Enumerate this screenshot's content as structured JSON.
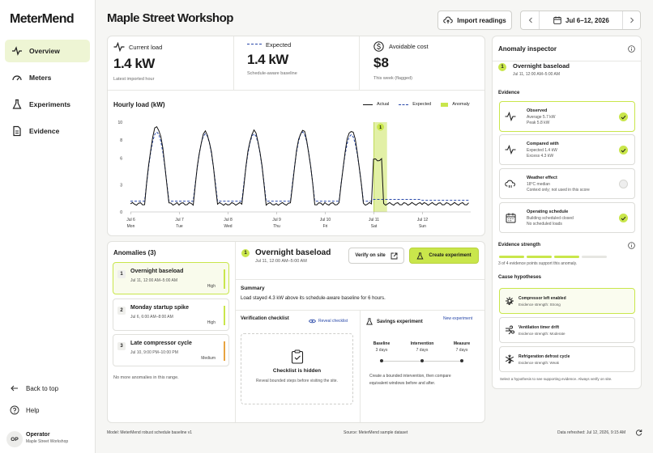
{
  "app": {
    "name": "MeterMend"
  },
  "sidebar": {
    "items": [
      {
        "label": "Overview",
        "icon": "pulse-icon"
      },
      {
        "label": "Meters",
        "icon": "gauge-icon"
      },
      {
        "label": "Experiments",
        "icon": "flask-icon"
      },
      {
        "label": "Evidence",
        "icon": "document-icon"
      }
    ],
    "back_to_top": "Back to top",
    "help": "Help",
    "user": {
      "initials": "OP",
      "name": "Operator",
      "org": "Maple Street Workshop"
    }
  },
  "header": {
    "title": "Maple Street Workshop",
    "import_label": "Import readings",
    "date_range": "Jul 6–12, 2026"
  },
  "kpis": [
    {
      "label": "Current load",
      "value": "1.4 kW",
      "sub": "Latest imported hour"
    },
    {
      "label": "Expected",
      "value": "1.4 kW",
      "sub": "Schedule-aware baseline"
    },
    {
      "label": "Avoidable cost",
      "value": "$8",
      "sub": "This week (flagged)"
    }
  ],
  "chart_data": {
    "type": "line",
    "title": "Hourly load (kW)",
    "ylim": [
      0,
      10
    ],
    "yticks": [
      0,
      3,
      6,
      8,
      10
    ],
    "x": [
      "Jul 6 Mon",
      "Jul 7 Tue",
      "Jul 8 Wed",
      "Jul 9 Thu",
      "Jul 10 Fri",
      "Jul 11 Sat",
      "Jul 12 Sun"
    ],
    "legend": [
      "Actual",
      "Expected",
      "Anomaly"
    ],
    "series": [
      {
        "name": "Actual",
        "peaks": [
          9.5,
          8.9,
          9.0,
          9.1,
          9.1,
          5.8,
          0.9
        ],
        "baseline": 0.9
      },
      {
        "name": "Expected",
        "peaks": [
          8.9,
          8.7,
          8.7,
          8.9,
          8.6,
          1.4,
          1.3
        ],
        "baseline": 1.2
      }
    ],
    "anomaly": {
      "day": "Jul 11",
      "marker": "1"
    }
  },
  "anomalies": {
    "title": "Anomalies (3)",
    "footer": "No more anomalies in this range.",
    "items": [
      {
        "num": "1",
        "name": "Overnight baseload",
        "time": "Jul 11, 12:00 AM–5:00 AM",
        "severity": "High",
        "color": "#c9e64b"
      },
      {
        "num": "2",
        "name": "Monday startup spike",
        "time": "Jul 6, 6:00 AM–8:00 AM",
        "severity": "High",
        "color": "#c9e64b"
      },
      {
        "num": "3",
        "name": "Late compressor cycle",
        "time": "Jul 10, 9:00 PM–10:00 PM",
        "severity": "Medium",
        "color": "#e8a340"
      }
    ]
  },
  "detail": {
    "num": "1",
    "title": "Overnight baseload",
    "time": "Jul 11, 12:00 AM–5:00 AM",
    "verify_label": "Verify on site",
    "create_label": "Create experiment",
    "summary_title": "Summary",
    "summary": "Load stayed 4.3 kW above its schedule-aware baseline for 6 hours.",
    "checklist_title": "Verification checklist",
    "reveal_label": "Reveal checklist",
    "hidden_title": "Checklist is hidden",
    "hidden_sub": "Reveal bounded steps before visiting the site.",
    "savings_title": "Savings experiment",
    "new_label": "New experiment",
    "phases": [
      {
        "name": "Baseline",
        "days": "3 days"
      },
      {
        "name": "Intervention",
        "days": "7 days"
      },
      {
        "name": "Measure",
        "days": "7 days"
      }
    ],
    "savings_note": "Create a bounded intervention, then compare equivalent windows before and after."
  },
  "inspector": {
    "title": "Anomaly inspector",
    "num": "1",
    "name": "Overnight baseload",
    "time": "Jul 11, 12:00 AM–5:00 AM",
    "evidence_label": "Evidence",
    "evidence": [
      {
        "title": "Observed",
        "l1": "Average 5.7 kW",
        "l2": "Peak 5.8 kW",
        "state": "check"
      },
      {
        "title": "Compared with",
        "l1": "Expected 1.4 kW",
        "l2": "Excess 4.3 kW",
        "state": "check"
      },
      {
        "title": "Weather effect",
        "l1": "18°C median",
        "l2": "Context only; not used in this score",
        "state": "neutral"
      },
      {
        "title": "Operating schedule",
        "l1": "Building scheduled closed",
        "l2": "No scheduled loads",
        "state": "check"
      }
    ],
    "strength_label": "Evidence strength",
    "strength_value": 3,
    "strength_max": 4,
    "strength_note": "3 of 4 evidence points support this anomaly.",
    "hypotheses_label": "Cause hypotheses",
    "hypotheses": [
      {
        "title": "Compressor left enabled",
        "sub": "Evidence strength: Strong",
        "mark": "check"
      },
      {
        "title": "Ventilation timer drift",
        "sub": "Evidence strength: Moderate",
        "mark": "chevron"
      },
      {
        "title": "Refrigeration defrost cycle",
        "sub": "Evidence strength: Weak",
        "mark": "chevron"
      }
    ],
    "hyp_note": "Select a hypothesis to see supporting evidence. Always verify on site."
  },
  "footer": {
    "model": "Model: MeterMend robust schedule baseline v1",
    "source": "Source: MeterMend sample dataset",
    "refreshed": "Data refreshed: Jul 12, 2026, 9:15 AM"
  }
}
